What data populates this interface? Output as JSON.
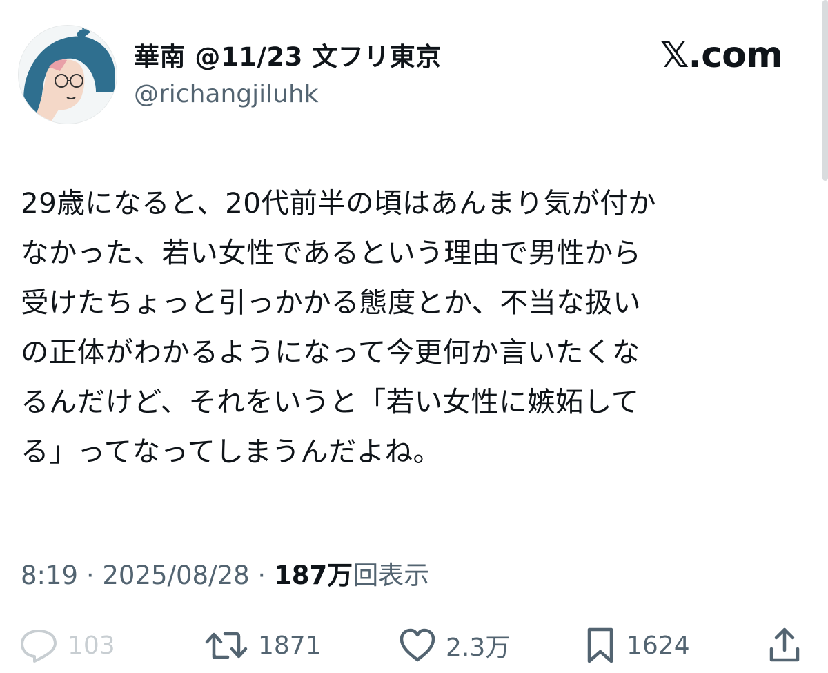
{
  "author": {
    "display_name": "華南 @11/23 文フリ東京",
    "handle": "@richangjiluhk",
    "avatar_icon": "illustrated-avatar"
  },
  "brand": {
    "label": "𝕏.com"
  },
  "tweet": {
    "lines": [
      "29歳になると、20代前半の頃はあんまり気が付か",
      "なかった、若い女性であるという理由で男性から",
      "受けたちょっと引っかかる態度とか、不当な扱い",
      "の正体がわかるようになって今更何か言いたくな",
      "るんだけど、それをいうと「若い女性に嫉妬して",
      "る」ってなってしまうんだよね。"
    ]
  },
  "meta": {
    "time": "8:19",
    "separator": "·",
    "date": "2025/08/28",
    "views_count": "187万",
    "views_label": "回表示"
  },
  "actions": {
    "reply": {
      "icon": "reply-icon",
      "count": "103"
    },
    "retweet": {
      "icon": "retweet-icon",
      "count": "1871"
    },
    "like": {
      "icon": "heart-icon",
      "count": "2.3万"
    },
    "bookmark": {
      "icon": "bookmark-icon",
      "count": "1624"
    },
    "share": {
      "icon": "share-icon"
    }
  },
  "colors": {
    "text": "#0f1419",
    "secondary": "#536471",
    "faded_reply": "#c8ced2",
    "avatar_teal": "#2f6f8f",
    "avatar_pink": "#e8a0a8"
  }
}
